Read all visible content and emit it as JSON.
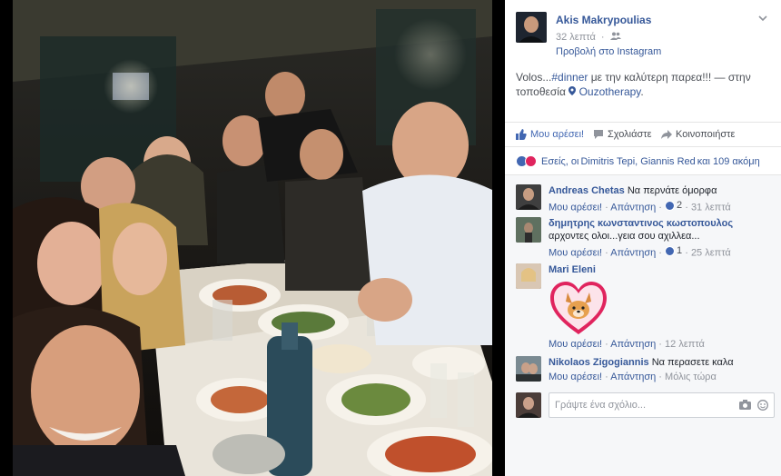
{
  "post": {
    "author": "Akis Makrypoulias",
    "time": "32 λεπτά",
    "via": "Προβολή στο Instagram",
    "text_prefix": "Volos...",
    "hashtag": "#dinner",
    "text_middle": " με την καλύτερη παρεα!!! — στην τοποθεσία ",
    "location": "Ouzotherapy",
    "text_end": "."
  },
  "actions": {
    "like": "Μου αρέσει!",
    "comment": "Σχολιάστε",
    "share": "Κοινοποιήστε"
  },
  "likes_summary": {
    "prefix": "Εσείς, οι ",
    "names": "Dimitris Tepi, Giannis Red",
    "suffix": " και 109 ακόμη"
  },
  "comments": [
    {
      "name": "Andreas Chetas",
      "text": "Να περνάτε όμορφα",
      "like": "Μου αρέσει!",
      "reply": "Απάντηση",
      "count": "2",
      "time": "31 λεπτά"
    },
    {
      "name": "δημητρης κωνσταντινος κωστοπουλος",
      "text": "αρχοντες ολοι...γεια σου αχιλλεα...",
      "like": "Μου αρέσει!",
      "reply": "Απάντηση",
      "count": "1",
      "time": "25 λεπτά"
    },
    {
      "name": "Mari Eleni",
      "text": "",
      "like": "Μου αρέσει!",
      "reply": "Απάντηση",
      "time": "12 λεπτά"
    },
    {
      "name": "Nikolaos Zigogiannis",
      "text": "Να περασετε καλα",
      "like": "Μου αρέσει!",
      "reply": "Απάντηση",
      "time": "Μόλις τώρα"
    }
  ],
  "comment_input": {
    "placeholder": "Γράψτε ένα σχόλιο..."
  },
  "colors": {
    "link": "#365899",
    "like_blue": "#4267b2",
    "heart": "#e0245e"
  }
}
